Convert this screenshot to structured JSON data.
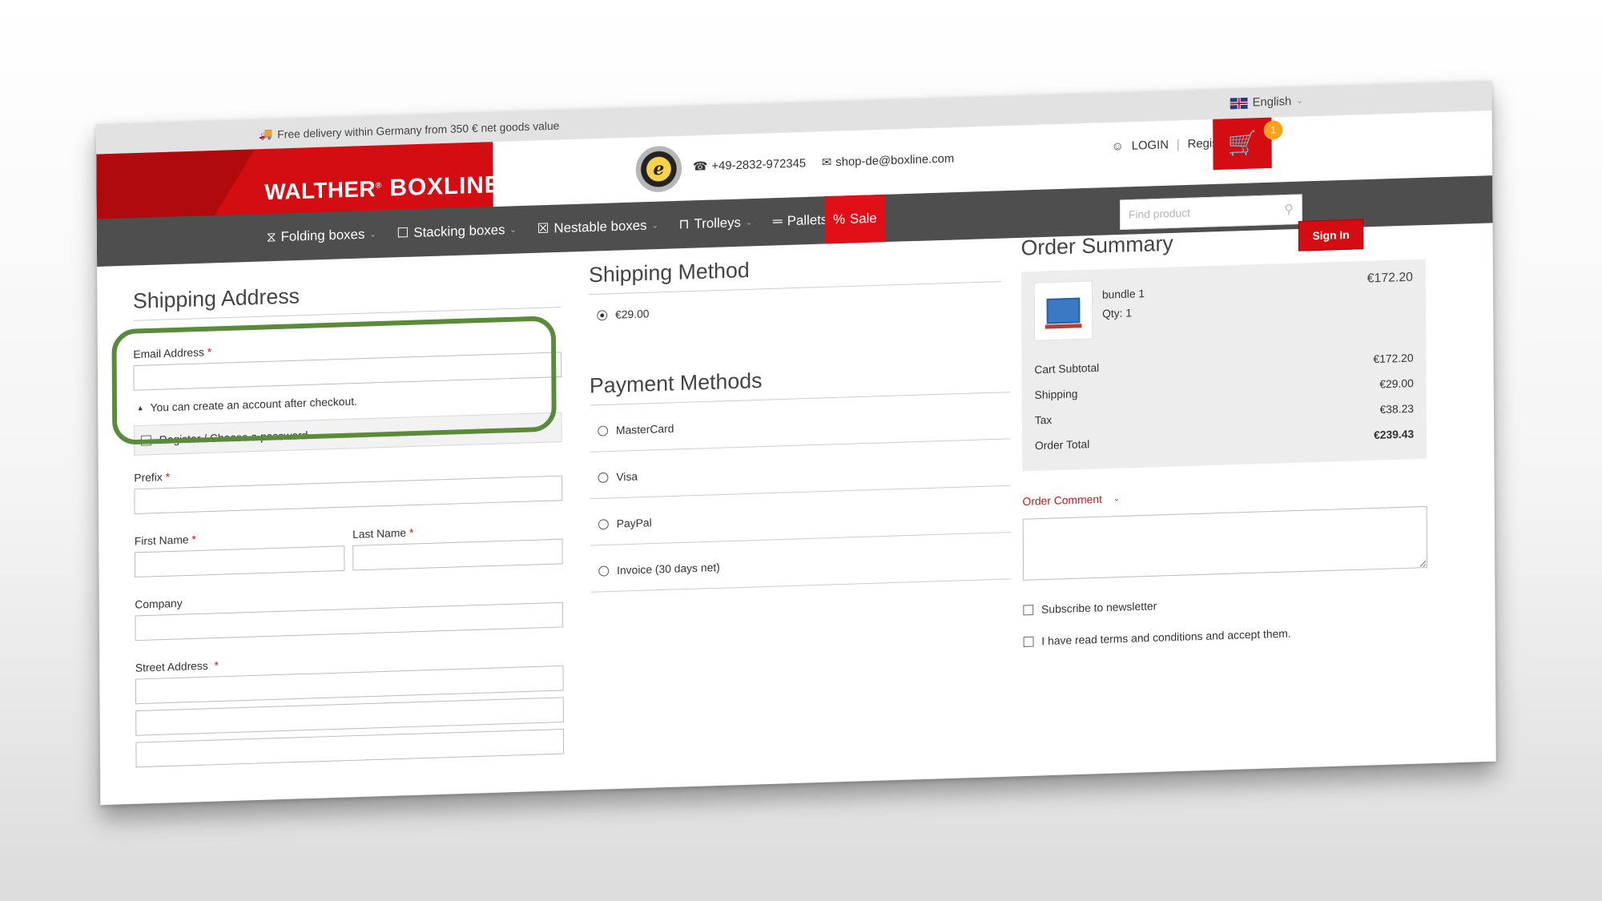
{
  "topbar": {
    "delivery_text": "Free delivery within Germany from 350 € net goods value",
    "language": "English"
  },
  "header": {
    "logo_brand": "WALTHER",
    "logo_product": "BOXLINE",
    "phone": "+49-2832-972345",
    "email": "shop-de@boxline.com",
    "login_label": "LOGIN",
    "register_label": "Register",
    "cart_count": "1"
  },
  "nav": {
    "items": [
      {
        "label": "Folding boxes"
      },
      {
        "label": "Stacking boxes"
      },
      {
        "label": "Nestable boxes"
      },
      {
        "label": "Trolleys"
      },
      {
        "label": "Pallets"
      }
    ],
    "sale_label": "Sale",
    "search_placeholder": "Find product"
  },
  "shipping_address": {
    "title": "Shipping Address",
    "email_label": "Email Address",
    "hint": "You can create an account after checkout.",
    "register_label": "Register / Choose a password",
    "prefix_label": "Prefix",
    "first_name_label": "First Name",
    "last_name_label": "Last Name",
    "company_label": "Company",
    "street_label": "Street Address"
  },
  "shipping_method": {
    "title": "Shipping Method",
    "option": "€29.00"
  },
  "payment_methods": {
    "title": "Payment Methods",
    "options": [
      "MasterCard",
      "Visa",
      "PayPal",
      "Invoice (30 days net)"
    ]
  },
  "order_summary": {
    "title": "Order Summary",
    "sign_in": "Sign In",
    "item_name": "bundle 1",
    "item_qty": "Qty: 1",
    "item_price": "€172.20",
    "rows": [
      {
        "label": "Cart Subtotal",
        "value": "€172.20"
      },
      {
        "label": "Shipping",
        "value": "€29.00"
      },
      {
        "label": "Tax",
        "value": "€38.23"
      },
      {
        "label": "Order Total",
        "value": "€239.43"
      }
    ],
    "comment_label": "Order Comment",
    "newsletter_label": "Subscribe to newsletter",
    "terms_label": "I have read terms and conditions and accept them."
  }
}
